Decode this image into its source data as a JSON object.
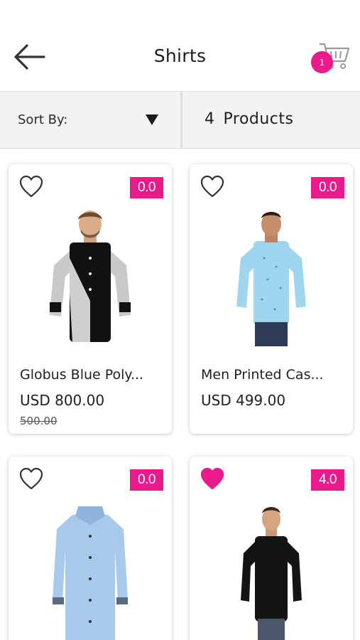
{
  "header": {
    "title": "Shirts",
    "cart_count": "1"
  },
  "filter": {
    "sort_label": "Sort By:",
    "count_number": "4",
    "count_label": "Products"
  },
  "accent_color": "#ea1a8b",
  "products": [
    {
      "name": "Globus Blue Poly...",
      "price": "USD 800.00",
      "old_price": "500.00",
      "rating": "0.0",
      "favorite": false
    },
    {
      "name": "Men Printed Cas...",
      "price": "USD 499.00",
      "old_price": "",
      "rating": "0.0",
      "favorite": false
    },
    {
      "name": "",
      "price": "",
      "old_price": "",
      "rating": "0.0",
      "favorite": false
    },
    {
      "name": "",
      "price": "",
      "old_price": "",
      "rating": "4.0",
      "favorite": true
    }
  ],
  "icons": {
    "back": "arrow-left-icon",
    "cart": "cart-icon",
    "sort": "caret-down-icon",
    "favorite": "heart-icon"
  }
}
